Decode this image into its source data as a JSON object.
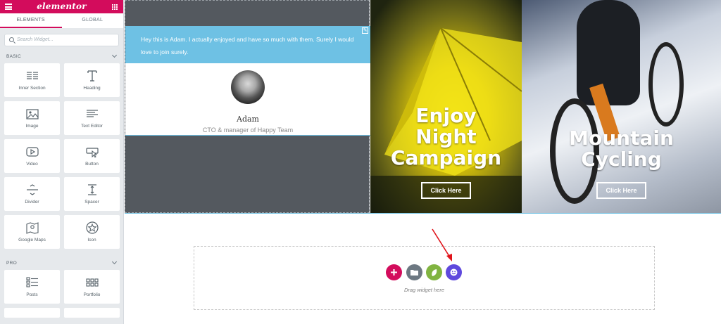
{
  "sidebar": {
    "logo": "elementor",
    "tabs": [
      "ELEMENTS",
      "GLOBAL"
    ],
    "search_placeholder": "Search Widget...",
    "basic_label": "BASIC",
    "pro_label": "PRO",
    "basic_widgets": [
      {
        "label": "Inner Section",
        "icon": "columns-icon"
      },
      {
        "label": "Heading",
        "icon": "heading-icon"
      },
      {
        "label": "Image",
        "icon": "image-icon"
      },
      {
        "label": "Text Editor",
        "icon": "text-editor-icon"
      },
      {
        "label": "Video",
        "icon": "video-icon"
      },
      {
        "label": "Button",
        "icon": "button-icon"
      },
      {
        "label": "Divider",
        "icon": "divider-icon"
      },
      {
        "label": "Spacer",
        "icon": "spacer-icon"
      },
      {
        "label": "Google Maps",
        "icon": "map-icon"
      },
      {
        "label": "Icon",
        "icon": "star-icon"
      }
    ],
    "pro_widgets": [
      {
        "label": "Posts",
        "icon": "posts-icon"
      },
      {
        "label": "Portfolio",
        "icon": "portfolio-icon"
      }
    ]
  },
  "testimonial": {
    "quote": "Hey this is Adam. I actually enjoyed and have so much with them. Surely I would love to join surely.",
    "name": "Adam",
    "role": "CTO & manager of Happy Team"
  },
  "banners": [
    {
      "title": "Enjoy Night Campaign",
      "button": "Click Here"
    },
    {
      "title": "Mountain Cycling",
      "button": "Click Here"
    }
  ],
  "dropzone": {
    "text": "Drag widget here",
    "buttons": [
      {
        "name": "add-section",
        "color": "#d30c5c"
      },
      {
        "name": "add-template",
        "color": "#6d7882"
      },
      {
        "name": "envato-elements",
        "color": "#81b441"
      },
      {
        "name": "happy-addons-templates",
        "color": "#5f49dd"
      }
    ]
  },
  "colors": {
    "brand": "#d30c5c",
    "accent": "#6ec1e4",
    "arrow": "#e0141b"
  }
}
